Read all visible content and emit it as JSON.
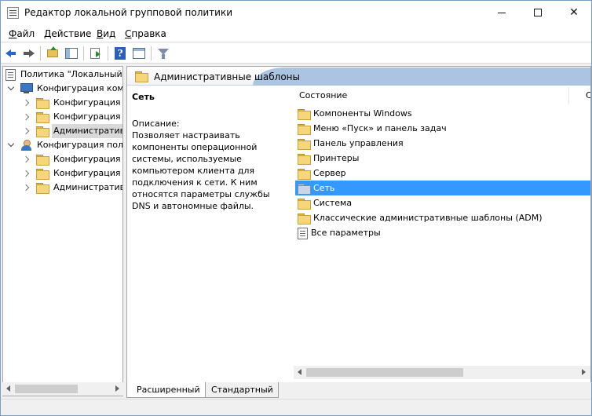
{
  "window": {
    "title": "Редактор локальной групповой политики"
  },
  "menu": {
    "items": [
      {
        "u": "Ф",
        "rest": "айл"
      },
      {
        "u": "Д",
        "rest": "ействие"
      },
      {
        "u": "В",
        "rest": "ид"
      },
      {
        "u": "С",
        "rest": "правка"
      }
    ]
  },
  "toolbar": {
    "icons": [
      "back-arrow-icon",
      "forward-arrow-icon",
      "folder-up-icon",
      "show-tree-icon",
      "export-list-icon",
      "help-icon",
      "properties-icon",
      "filter-icon"
    ]
  },
  "tree": {
    "items": [
      {
        "label": "Политика \"Локальный"
      },
      {
        "label": "Конфигурация комп"
      },
      {
        "label": "Конфигурация п"
      },
      {
        "label": "Конфигурация W"
      },
      {
        "label": "Административ"
      },
      {
        "label": "Конфигурация поль"
      },
      {
        "label": "Конфигурация п"
      },
      {
        "label": "Конфигурация W"
      },
      {
        "label": "Административ"
      }
    ]
  },
  "content": {
    "header_title": "Административные шаблоны",
    "desc_title": "Сеть",
    "desc_label": "Описание:",
    "desc_text": "Позволяет настраивать компоненты операционной системы, используемые компьютером клиента для подключения к сети. К ним относятся параметры службы DNS и автономные файлы.",
    "column_state": "Состояние",
    "column_state2": "С",
    "items": [
      {
        "label": "Компоненты Windows"
      },
      {
        "label": "Меню «Пуск» и панель задач"
      },
      {
        "label": "Панель управления"
      },
      {
        "label": "Принтеры"
      },
      {
        "label": "Сервер"
      },
      {
        "label": "Сеть"
      },
      {
        "label": "Система"
      },
      {
        "label": "Классические административные шаблоны (ADM)"
      },
      {
        "label": "Все параметры"
      }
    ]
  },
  "tabs": [
    {
      "label": "Расширенный"
    },
    {
      "label": "Стандартный"
    }
  ],
  "colors": {
    "selection": "#3399ff",
    "header_band": "#aac4e2"
  }
}
